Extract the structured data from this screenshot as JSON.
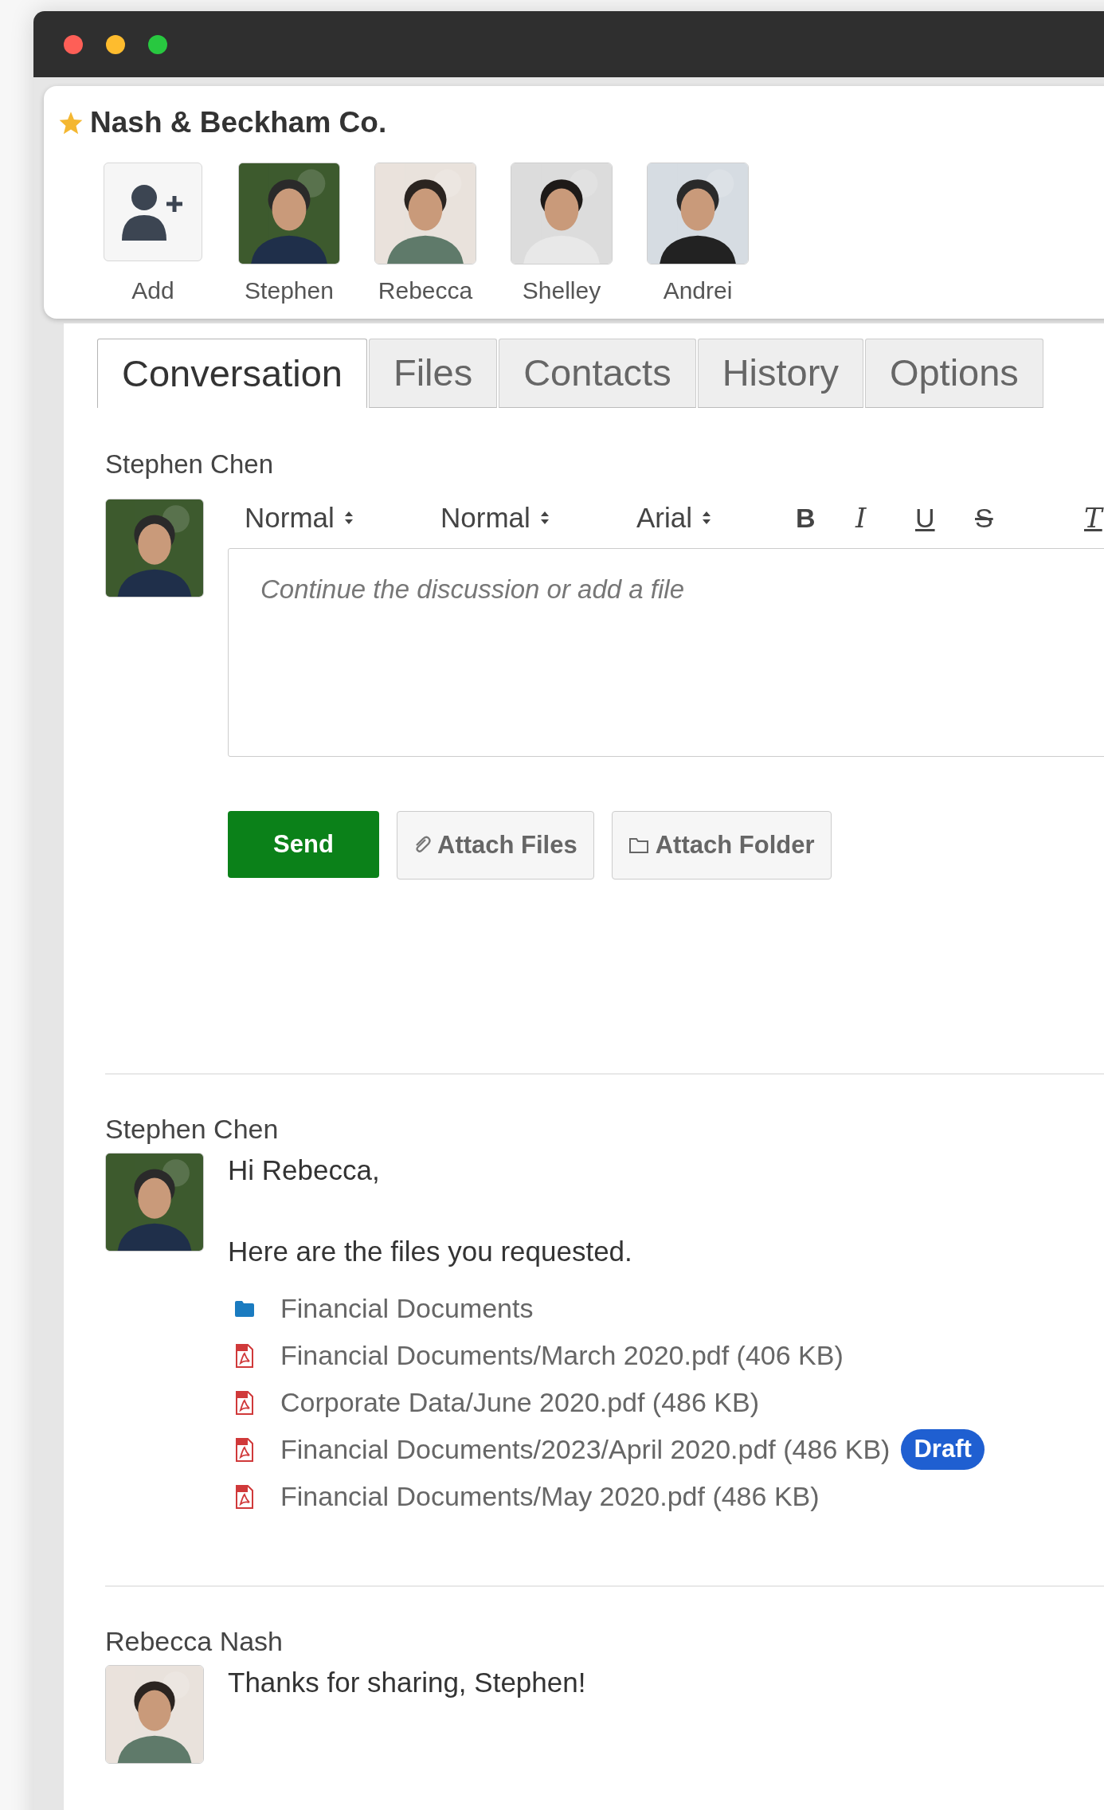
{
  "company": {
    "name": "Nash & Beckham Co.",
    "starred": true
  },
  "people": [
    {
      "kind": "add",
      "label": "Add"
    },
    {
      "kind": "person",
      "label": "Stephen"
    },
    {
      "kind": "person",
      "label": "Rebecca"
    },
    {
      "kind": "person",
      "label": "Shelley"
    },
    {
      "kind": "person",
      "label": "Andrei"
    }
  ],
  "tabs": [
    {
      "label": "Conversation",
      "selected": true
    },
    {
      "label": "Files",
      "selected": false
    },
    {
      "label": "Contacts",
      "selected": false
    },
    {
      "label": "History",
      "selected": false
    },
    {
      "label": "Options",
      "selected": false
    }
  ],
  "composer": {
    "author": "Stephen Chen",
    "selects": [
      "Normal",
      "Normal",
      "Arial"
    ],
    "format_buttons": [
      {
        "kind": "bold",
        "label": "B"
      },
      {
        "kind": "italic",
        "label": "I"
      },
      {
        "kind": "underline",
        "label": "U"
      },
      {
        "kind": "strike",
        "label": "S"
      },
      {
        "kind": "clear",
        "label": "T"
      }
    ],
    "placeholder": "Continue the discussion or add a file",
    "buttons": [
      {
        "kind": "send",
        "label": "Send"
      },
      {
        "kind": "files",
        "label": "Attach Files"
      },
      {
        "kind": "folder",
        "label": "Attach Folder"
      }
    ]
  },
  "messages": [
    {
      "author": "Stephen Chen",
      "paragraphs": [
        "Hi Rebecca,",
        "Here are the files you requested."
      ],
      "attachments": [
        {
          "kind": "folder",
          "name": "Financial Documents"
        },
        {
          "kind": "pdf",
          "name": "Financial Documents/March 2020.pdf (406 KB)"
        },
        {
          "kind": "pdf",
          "name": "Corporate Data/June 2020.pdf (486 KB)"
        },
        {
          "kind": "pdf",
          "name": "Financial Documents/2023/April 2020.pdf (486 KB)",
          "badge": "Draft"
        },
        {
          "kind": "pdf",
          "name": "Financial Documents/May 2020.pdf (486 KB)"
        }
      ]
    },
    {
      "author": "Rebecca Nash",
      "paragraphs": [
        "Thanks for sharing, Stephen!"
      ]
    }
  ]
}
